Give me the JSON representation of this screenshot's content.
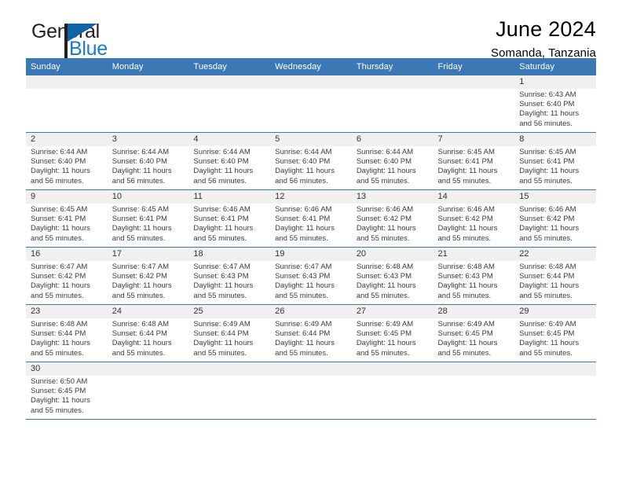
{
  "brand": {
    "name_top": "General",
    "name_bottom": "Blue",
    "logo_icon": "general-blue-triangle-logo",
    "color_top": "#231f20",
    "color_bottom": "#1a7dc4",
    "flag_color": "#0f64a8"
  },
  "header": {
    "title": "June 2024",
    "subtitle": "Somanda, Tanzania"
  },
  "theme": {
    "header_blue": "#3b78b5",
    "daynum_band": "#f0f0f0",
    "row_divider": "#3b78b5",
    "text": "#3c3c3c"
  },
  "calendar": {
    "weekday_headers": [
      "Sunday",
      "Monday",
      "Tuesday",
      "Wednesday",
      "Thursday",
      "Friday",
      "Saturday"
    ],
    "labels": {
      "sunrise": "Sunrise:",
      "sunset": "Sunset:",
      "daylight": "Daylight:"
    },
    "weeks": [
      [
        {
          "day": "",
          "empty": true,
          "lines": []
        },
        {
          "day": "",
          "empty": true,
          "lines": []
        },
        {
          "day": "",
          "empty": true,
          "lines": []
        },
        {
          "day": "",
          "empty": true,
          "lines": []
        },
        {
          "day": "",
          "empty": true,
          "lines": []
        },
        {
          "day": "",
          "empty": true,
          "lines": []
        },
        {
          "day": "1",
          "empty": false,
          "lines": [
            "Sunrise: 6:43 AM",
            "Sunset: 6:40 PM",
            "Daylight: 11 hours",
            "and 56 minutes."
          ]
        }
      ],
      [
        {
          "day": "2",
          "empty": false,
          "lines": [
            "Sunrise: 6:44 AM",
            "Sunset: 6:40 PM",
            "Daylight: 11 hours",
            "and 56 minutes."
          ]
        },
        {
          "day": "3",
          "empty": false,
          "lines": [
            "Sunrise: 6:44 AM",
            "Sunset: 6:40 PM",
            "Daylight: 11 hours",
            "and 56 minutes."
          ]
        },
        {
          "day": "4",
          "empty": false,
          "lines": [
            "Sunrise: 6:44 AM",
            "Sunset: 6:40 PM",
            "Daylight: 11 hours",
            "and 56 minutes."
          ]
        },
        {
          "day": "5",
          "empty": false,
          "lines": [
            "Sunrise: 6:44 AM",
            "Sunset: 6:40 PM",
            "Daylight: 11 hours",
            "and 56 minutes."
          ]
        },
        {
          "day": "6",
          "empty": false,
          "lines": [
            "Sunrise: 6:44 AM",
            "Sunset: 6:40 PM",
            "Daylight: 11 hours",
            "and 55 minutes."
          ]
        },
        {
          "day": "7",
          "empty": false,
          "lines": [
            "Sunrise: 6:45 AM",
            "Sunset: 6:41 PM",
            "Daylight: 11 hours",
            "and 55 minutes."
          ]
        },
        {
          "day": "8",
          "empty": false,
          "lines": [
            "Sunrise: 6:45 AM",
            "Sunset: 6:41 PM",
            "Daylight: 11 hours",
            "and 55 minutes."
          ]
        }
      ],
      [
        {
          "day": "9",
          "empty": false,
          "lines": [
            "Sunrise: 6:45 AM",
            "Sunset: 6:41 PM",
            "Daylight: 11 hours",
            "and 55 minutes."
          ]
        },
        {
          "day": "10",
          "empty": false,
          "lines": [
            "Sunrise: 6:45 AM",
            "Sunset: 6:41 PM",
            "Daylight: 11 hours",
            "and 55 minutes."
          ]
        },
        {
          "day": "11",
          "empty": false,
          "lines": [
            "Sunrise: 6:46 AM",
            "Sunset: 6:41 PM",
            "Daylight: 11 hours",
            "and 55 minutes."
          ]
        },
        {
          "day": "12",
          "empty": false,
          "lines": [
            "Sunrise: 6:46 AM",
            "Sunset: 6:41 PM",
            "Daylight: 11 hours",
            "and 55 minutes."
          ]
        },
        {
          "day": "13",
          "empty": false,
          "lines": [
            "Sunrise: 6:46 AM",
            "Sunset: 6:42 PM",
            "Daylight: 11 hours",
            "and 55 minutes."
          ]
        },
        {
          "day": "14",
          "empty": false,
          "lines": [
            "Sunrise: 6:46 AM",
            "Sunset: 6:42 PM",
            "Daylight: 11 hours",
            "and 55 minutes."
          ]
        },
        {
          "day": "15",
          "empty": false,
          "lines": [
            "Sunrise: 6:46 AM",
            "Sunset: 6:42 PM",
            "Daylight: 11 hours",
            "and 55 minutes."
          ]
        }
      ],
      [
        {
          "day": "16",
          "empty": false,
          "lines": [
            "Sunrise: 6:47 AM",
            "Sunset: 6:42 PM",
            "Daylight: 11 hours",
            "and 55 minutes."
          ]
        },
        {
          "day": "17",
          "empty": false,
          "lines": [
            "Sunrise: 6:47 AM",
            "Sunset: 6:42 PM",
            "Daylight: 11 hours",
            "and 55 minutes."
          ]
        },
        {
          "day": "18",
          "empty": false,
          "lines": [
            "Sunrise: 6:47 AM",
            "Sunset: 6:43 PM",
            "Daylight: 11 hours",
            "and 55 minutes."
          ]
        },
        {
          "day": "19",
          "empty": false,
          "lines": [
            "Sunrise: 6:47 AM",
            "Sunset: 6:43 PM",
            "Daylight: 11 hours",
            "and 55 minutes."
          ]
        },
        {
          "day": "20",
          "empty": false,
          "lines": [
            "Sunrise: 6:48 AM",
            "Sunset: 6:43 PM",
            "Daylight: 11 hours",
            "and 55 minutes."
          ]
        },
        {
          "day": "21",
          "empty": false,
          "lines": [
            "Sunrise: 6:48 AM",
            "Sunset: 6:43 PM",
            "Daylight: 11 hours",
            "and 55 minutes."
          ]
        },
        {
          "day": "22",
          "empty": false,
          "lines": [
            "Sunrise: 6:48 AM",
            "Sunset: 6:44 PM",
            "Daylight: 11 hours",
            "and 55 minutes."
          ]
        }
      ],
      [
        {
          "day": "23",
          "empty": false,
          "lines": [
            "Sunrise: 6:48 AM",
            "Sunset: 6:44 PM",
            "Daylight: 11 hours",
            "and 55 minutes."
          ]
        },
        {
          "day": "24",
          "empty": false,
          "lines": [
            "Sunrise: 6:48 AM",
            "Sunset: 6:44 PM",
            "Daylight: 11 hours",
            "and 55 minutes."
          ]
        },
        {
          "day": "25",
          "empty": false,
          "lines": [
            "Sunrise: 6:49 AM",
            "Sunset: 6:44 PM",
            "Daylight: 11 hours",
            "and 55 minutes."
          ]
        },
        {
          "day": "26",
          "empty": false,
          "lines": [
            "Sunrise: 6:49 AM",
            "Sunset: 6:44 PM",
            "Daylight: 11 hours",
            "and 55 minutes."
          ]
        },
        {
          "day": "27",
          "empty": false,
          "lines": [
            "Sunrise: 6:49 AM",
            "Sunset: 6:45 PM",
            "Daylight: 11 hours",
            "and 55 minutes."
          ]
        },
        {
          "day": "28",
          "empty": false,
          "lines": [
            "Sunrise: 6:49 AM",
            "Sunset: 6:45 PM",
            "Daylight: 11 hours",
            "and 55 minutes."
          ]
        },
        {
          "day": "29",
          "empty": false,
          "lines": [
            "Sunrise: 6:49 AM",
            "Sunset: 6:45 PM",
            "Daylight: 11 hours",
            "and 55 minutes."
          ]
        }
      ],
      [
        {
          "day": "30",
          "empty": false,
          "lines": [
            "Sunrise: 6:50 AM",
            "Sunset: 6:45 PM",
            "Daylight: 11 hours",
            "and 55 minutes."
          ]
        },
        {
          "day": "",
          "empty": true,
          "lines": []
        },
        {
          "day": "",
          "empty": true,
          "lines": []
        },
        {
          "day": "",
          "empty": true,
          "lines": []
        },
        {
          "day": "",
          "empty": true,
          "lines": []
        },
        {
          "day": "",
          "empty": true,
          "lines": []
        },
        {
          "day": "",
          "empty": true,
          "lines": []
        }
      ]
    ]
  }
}
